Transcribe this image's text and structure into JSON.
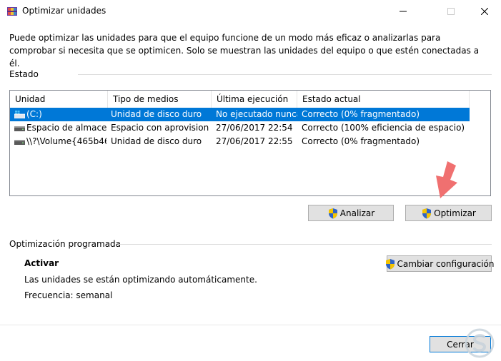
{
  "window": {
    "title": "Optimizar unidades",
    "controls": [
      "minimize-icon",
      "maximize-icon",
      "close-icon"
    ]
  },
  "description": "Puede optimizar las unidades para que el equipo funcione de un modo más eficaz o analizarlas para comprobar si necesita que se optimicen. Solo se muestran las unidades del equipo o que estén conectadas a él.",
  "status_section": {
    "label": "Estado",
    "columns": [
      "Unidad",
      "Tipo de medios",
      "Última ejecución",
      "Estado actual"
    ],
    "rows": [
      {
        "drive": "(C:)",
        "media": "Unidad de disco duro",
        "last_run": "No ejecutado nunca",
        "status": "Correcto (0% fragmentado)",
        "icon": "windows-drive-icon",
        "selected": true
      },
      {
        "drive": "Espacio de almace...",
        "media": "Espacio con aprovision...",
        "last_run": "27/06/2017 22:54",
        "status": "Correcto (100% eficiencia de espacio)",
        "icon": "hard-drive-icon",
        "selected": false
      },
      {
        "drive": "\\\\?\\Volume{465b46...",
        "media": "Unidad de disco duro",
        "last_run": "27/06/2017 22:55",
        "status": "Correcto (0% fragmentado)",
        "icon": "hard-drive-icon",
        "selected": false
      }
    ]
  },
  "actions": {
    "analyze_label": "Analizar",
    "optimize_label": "Optimizar"
  },
  "scheduled": {
    "label": "Optimización programada",
    "heading": "Activar",
    "message": "Las unidades se están optimizando automáticamente.",
    "frequency": "Frecuencia: semanal",
    "change_settings_label": "Cambiar configuración"
  },
  "footer": {
    "close_label": "Cerrar"
  },
  "colors": {
    "selection": "#0078d7",
    "annotation_arrow": "#f07070",
    "shield_blue": "#2f64c8",
    "shield_yellow": "#f5c400"
  }
}
